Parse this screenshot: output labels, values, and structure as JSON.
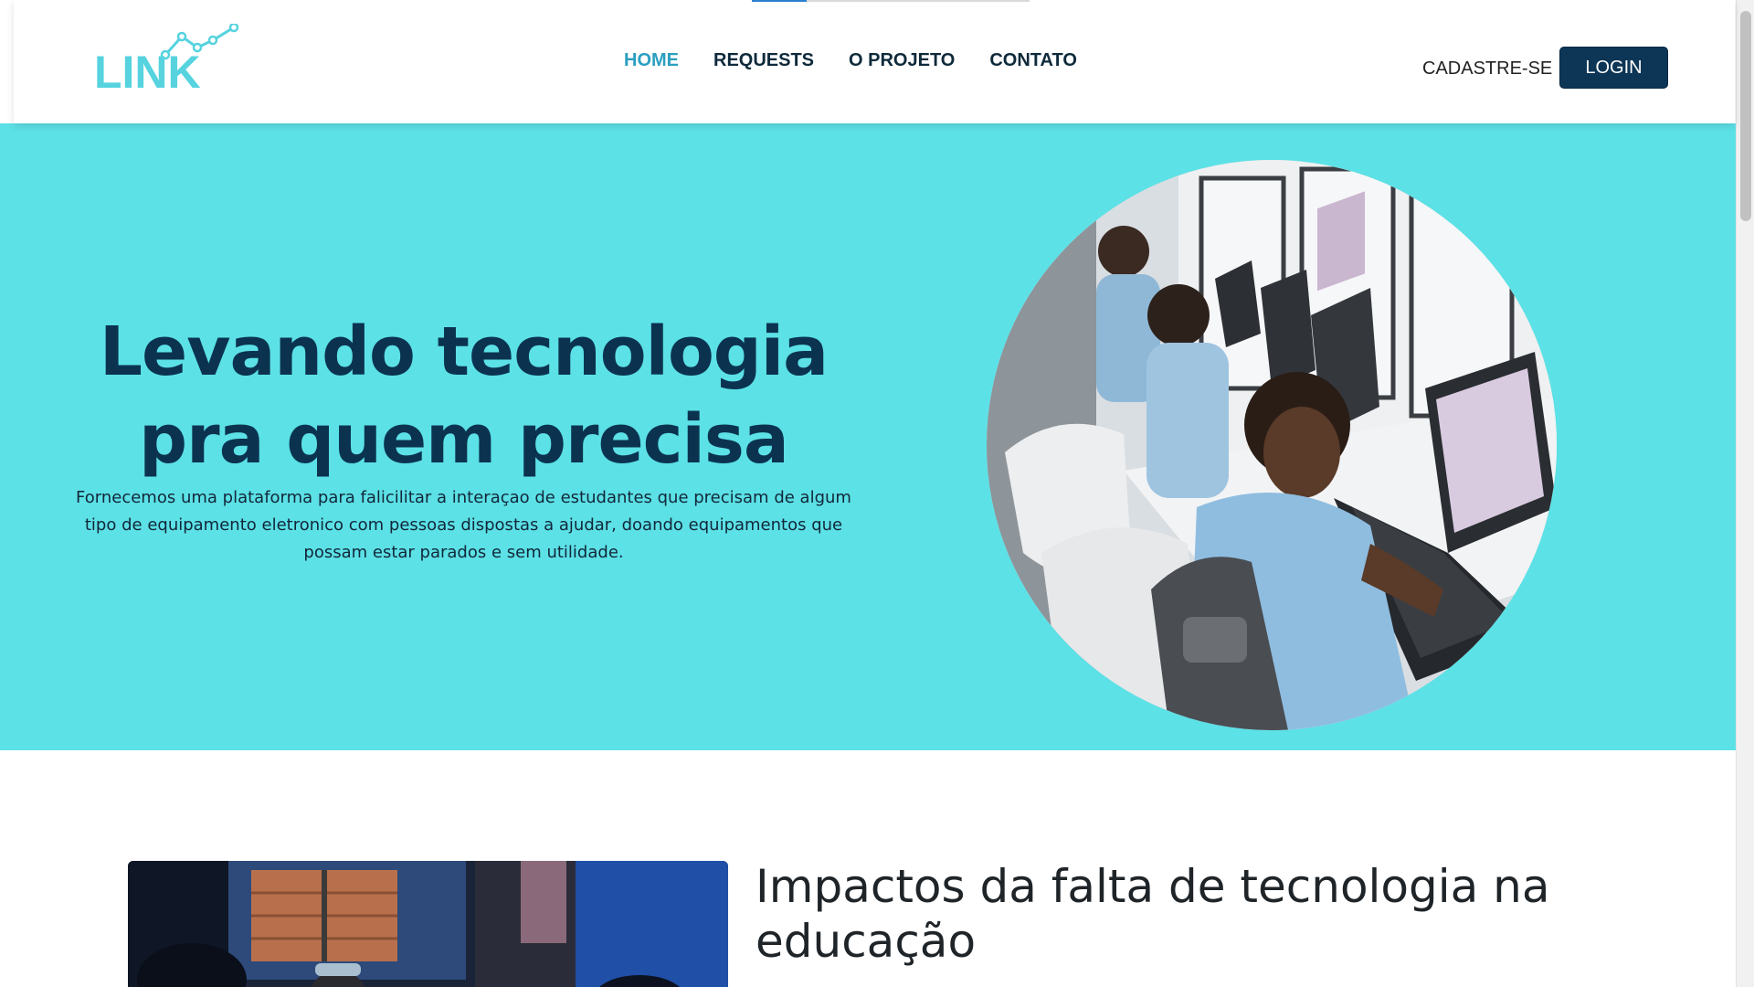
{
  "logo": {
    "text": "LINK",
    "icon": "trend-line-icon"
  },
  "nav": {
    "items": [
      {
        "label": "HOME",
        "active": true
      },
      {
        "label": "REQUESTS",
        "active": false
      },
      {
        "label": "O PROJETO",
        "active": false
      },
      {
        "label": "CONTATO",
        "active": false
      }
    ]
  },
  "auth": {
    "signup_label": "CADASTRE-SE",
    "login_label": "LOGIN"
  },
  "hero": {
    "title_line1": "Levando tecnologia",
    "title_line2": "pra quem precisa",
    "description": "Fornecemos uma plataforma para falicilitar a interaçao de estudantes que precisam de algum tipo de equipamento eletronico com pessoas dispostas a ajudar, doando equipamentos que possam estar parados e sem utilidade."
  },
  "impact": {
    "title": "Impactos da falta de tecnologia na educação"
  },
  "colors": {
    "hero_bg": "#5ce1e6",
    "brand_dark": "#0b3350",
    "nav_active": "#2a9fc0",
    "logo_color": "#56d3df",
    "login_bg": "#0c3556"
  }
}
